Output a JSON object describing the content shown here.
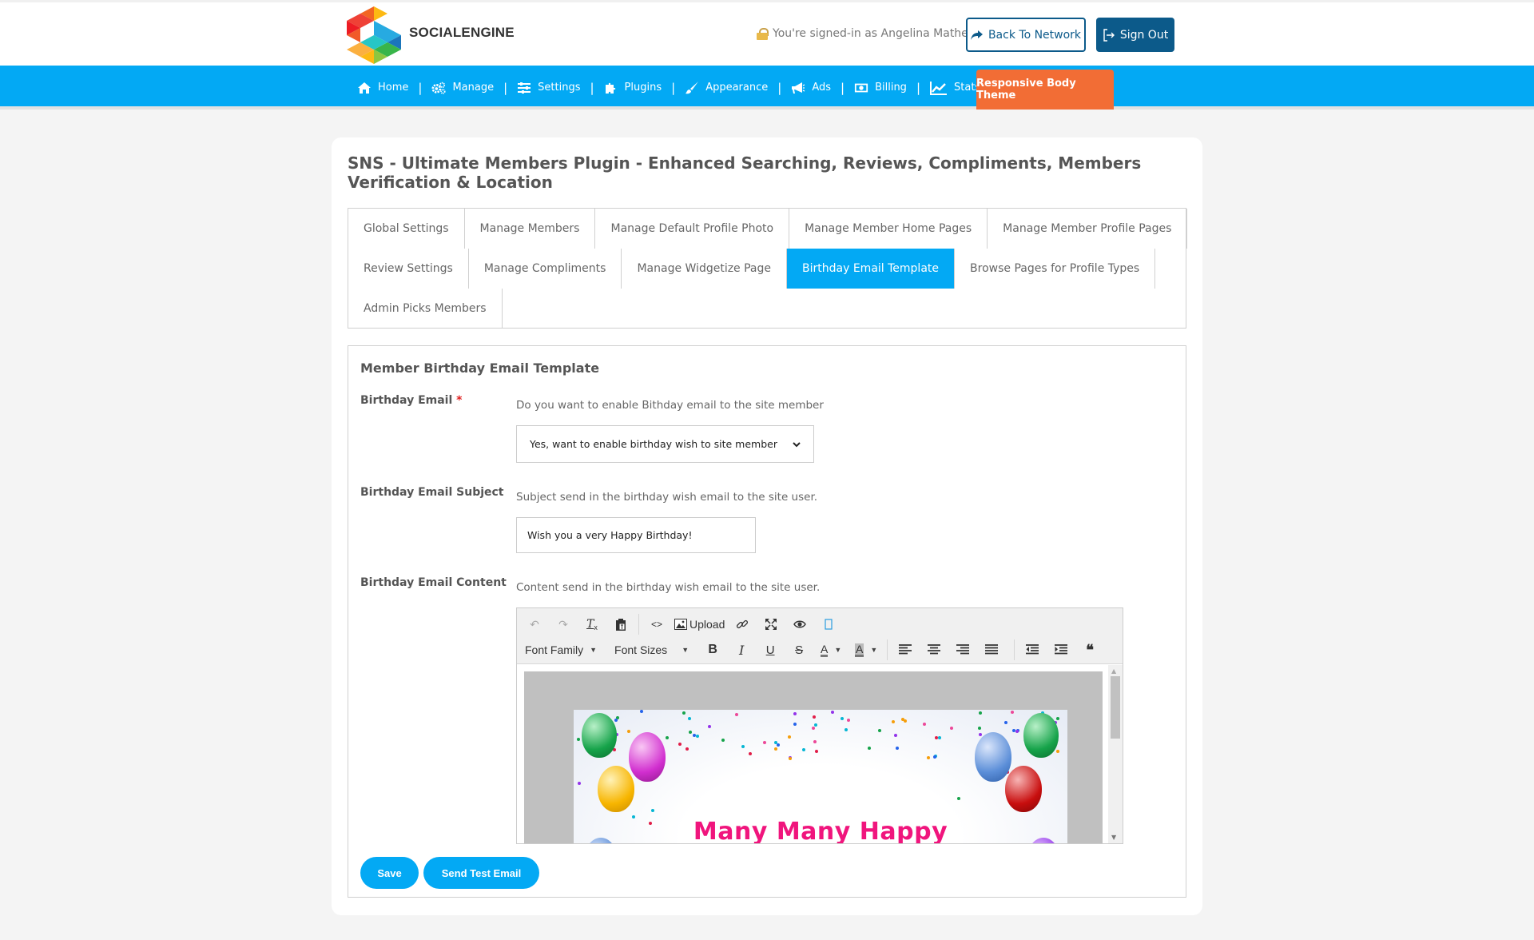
{
  "header": {
    "brand": "SOCIALENGINE",
    "signed_in_text": "You're signed-in as Angelina Mathew",
    "back_button": "Back To Network",
    "signout_button": "Sign Out",
    "colors": {
      "primary": "#0c5a8a"
    }
  },
  "nav": {
    "items": [
      {
        "label": "Home",
        "icon": "home-icon"
      },
      {
        "label": "Manage",
        "icon": "gears-icon"
      },
      {
        "label": "Settings",
        "icon": "sliders-icon"
      },
      {
        "label": "Plugins",
        "icon": "puzzle-icon"
      },
      {
        "label": "Appearance",
        "icon": "brush-icon"
      },
      {
        "label": "Ads",
        "icon": "megaphone-icon"
      },
      {
        "label": "Billing",
        "icon": "money-icon"
      },
      {
        "label": "Stats",
        "icon": "chart-icon"
      }
    ],
    "theme_button": "Responsive Body Theme",
    "colors": {
      "bar": "#03a9f4",
      "theme": "#f26d35"
    }
  },
  "page": {
    "title": "SNS - Ultimate Members Plugin - Enhanced Searching, Reviews, Compliments, Members Verification & Location"
  },
  "tabs": {
    "row1": [
      "Global Settings",
      "Manage Members",
      "Manage Default Profile Photo",
      "Manage Member Home Pages",
      "Manage Member Profile Pages"
    ],
    "row2": [
      "Review Settings",
      "Manage Compliments",
      "Manage Widgetize Page",
      "Birthday Email Template",
      "Browse Pages for Profile Types"
    ],
    "row3": [
      "Admin Picks Members"
    ],
    "active": "Birthday Email Template"
  },
  "form": {
    "title": "Member Birthday Email Template",
    "birthday_email": {
      "label": "Birthday Email",
      "required_mark": "*",
      "description": "Do you want to enable Bithday email to the site member",
      "selected": "Yes, want to enable birthday wish to site member"
    },
    "subject": {
      "label": "Birthday Email Subject",
      "description": "Subject send in the birthday wish email to the site user.",
      "value": "Wish you a very Happy Birthday!"
    },
    "content": {
      "label": "Birthday Email Content",
      "description": "Content send in the birthday wish email to the site user.",
      "toolbar": {
        "upload": "Upload",
        "font_family": "Font Family",
        "font_sizes": "Font Sizes",
        "bold": "B",
        "italic": "I",
        "underline": "U",
        "strike": "S",
        "text_color": "A",
        "bg_color": "A",
        "quote": "❝"
      },
      "preview_text": "Many Many Happy"
    },
    "save_button": "Save",
    "test_button": "Send Test Email"
  }
}
